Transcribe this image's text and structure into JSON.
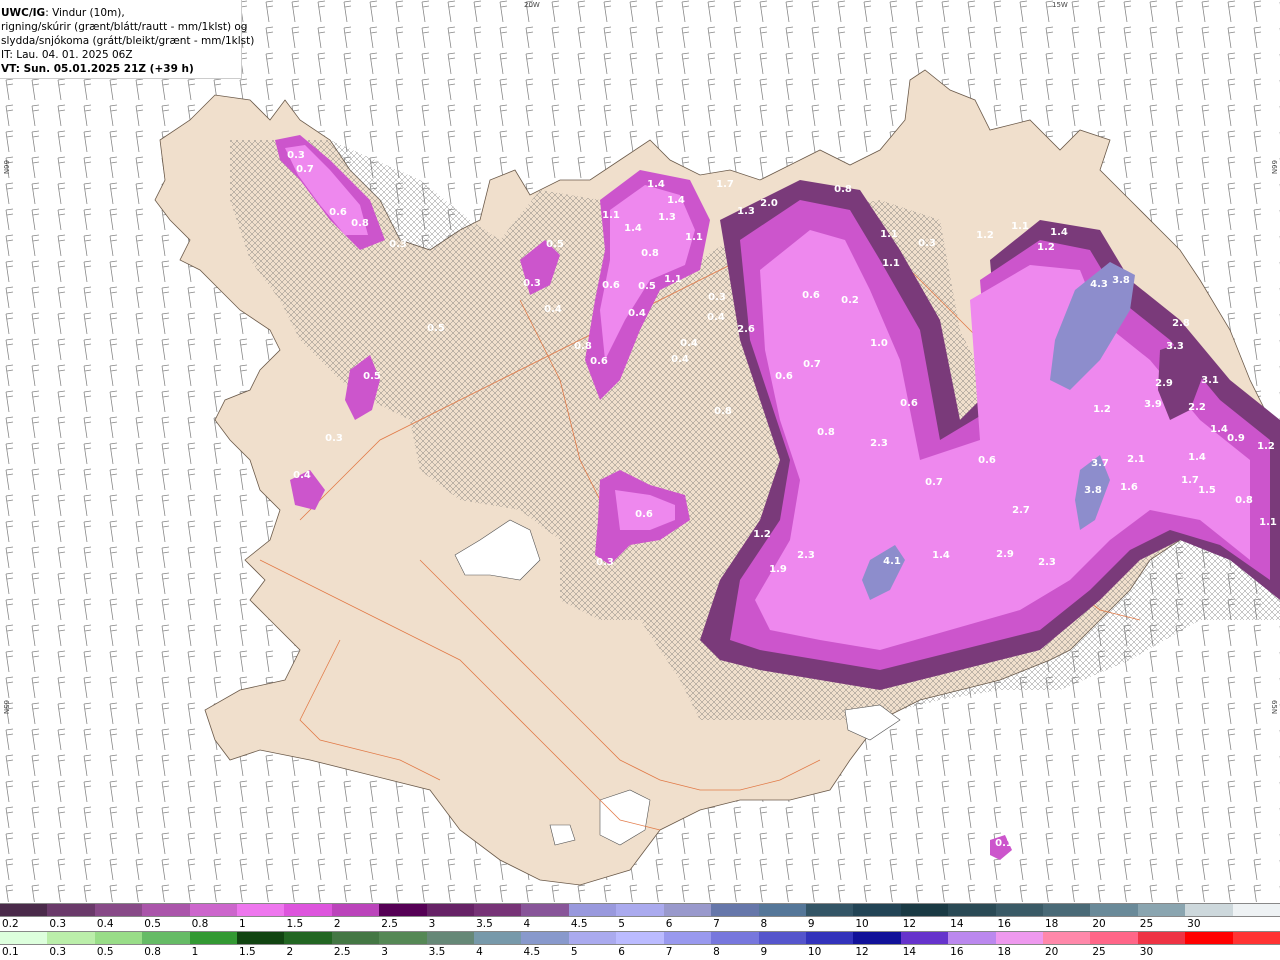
{
  "header": {
    "source": "UWC/IG",
    "line1_rest": ": Vindur (10m),",
    "line2": "rigning/skúrir (grænt/blátt/rautt - mm/1klst) og",
    "line3": "slydda/snjókoma (grátt/bleikt/grænt - mm/1klst)",
    "line4": "IT: Lau. 04. 01. 2025 06Z",
    "line5": "VT: Sun. 05.01.2025 21Z (+39 h)"
  },
  "graticule": {
    "lon_labels": [
      "20W",
      "15W"
    ],
    "lat_labels": [
      "66N",
      "66N",
      "65N",
      "65N"
    ]
  },
  "colors": {
    "land": "#f0dfcc",
    "sea": "#ffffff",
    "roads": "#e0703a",
    "coast": "#5a4a3a",
    "snow_light": "#ee88ee",
    "snow_mid": "#cc55cc",
    "snow_dark": "#7a3a7a",
    "snow_heavy": "#8d8dcc"
  },
  "precip_labels": [
    "0.3",
    "0.7",
    "0.6",
    "0.8",
    "0.5",
    "0.3",
    "0.4",
    "0.3",
    "0.5",
    "0.3",
    "0.4",
    "1.4",
    "1.1",
    "1.4",
    "1.3",
    "1.4",
    "1.1",
    "0.8",
    "0.6",
    "0.5",
    "1.1",
    "0.4",
    "0.8",
    "0.6",
    "0.5",
    "1.7",
    "1.3",
    "2.0",
    "1.1",
    "1.1",
    "0.8",
    "0.3",
    "0.3",
    "0.4",
    "0.4",
    "0.4",
    "2.6",
    "0.6",
    "0.2",
    "1.2",
    "1.1",
    "1.2",
    "1.4",
    "4.3",
    "3.8",
    "2.8",
    "3.3",
    "2.9",
    "3.1",
    "3.9",
    "2.2",
    "1.4",
    "1.0",
    "0.7",
    "0.6",
    "0.6",
    "0.8",
    "0.8",
    "2.3",
    "1.2",
    "0.6",
    "0.7",
    "3.7",
    "2.1",
    "1.6",
    "1.4",
    "1.7",
    "1.5",
    "0.9",
    "1.2",
    "0.8",
    "1.1",
    "2.7",
    "3.8",
    "1.2",
    "2.3",
    "1.9",
    "4.1",
    "1.4",
    "2.9",
    "2.3",
    "0.6",
    "0.3",
    "0.3",
    "0.1"
  ],
  "legend_snow": {
    "labels": [
      "0.2",
      "0.3",
      "0.4",
      "0.5",
      "0.8",
      "1",
      "1.5",
      "2",
      "2.5",
      "3",
      "3.5",
      "4",
      "4.5",
      "5",
      "6",
      "7",
      "8",
      "9",
      "10",
      "12",
      "14",
      "16",
      "18",
      "20",
      "25",
      "30"
    ],
    "colors": [
      "#4a2a4a",
      "#6a3a6a",
      "#884a88",
      "#aa55aa",
      "#cc66cc",
      "#ee77ee",
      "#dd55dd",
      "#bb44bb",
      "#550055",
      "#662266",
      "#773377",
      "#885599",
      "#9999dd",
      "#aaaaee",
      "#9999cc",
      "#6677aa",
      "#557799",
      "#335566",
      "#224455",
      "#1a3a44",
      "#2a4a55",
      "#3a5a66",
      "#4a6a77",
      "#6a8a99",
      "#8aa5b0",
      "#cdd8dc",
      "#eef2f4"
    ]
  },
  "legend_rain": {
    "labels": [
      "0.1",
      "0.3",
      "0.5",
      "0.8",
      "1",
      "1.5",
      "2",
      "2.5",
      "3",
      "3.5",
      "4",
      "4.5",
      "5",
      "6",
      "7",
      "8",
      "9",
      "10",
      "12",
      "14",
      "16",
      "18",
      "20",
      "25",
      "30"
    ],
    "colors": [
      "#ddffdd",
      "#bbeeaa",
      "#99dd88",
      "#66bb66",
      "#339933",
      "#114411",
      "#226622",
      "#447744",
      "#558855",
      "#668877",
      "#7799aa",
      "#8899cc",
      "#aaaaee",
      "#bbbbff",
      "#9999ee",
      "#7777dd",
      "#5555cc",
      "#3333bb",
      "#111199",
      "#6633cc",
      "#bb88ee",
      "#ee99ee",
      "#ff88aa",
      "#ff6688",
      "#ee3344",
      "#ff0000",
      "#ff3333"
    ]
  }
}
